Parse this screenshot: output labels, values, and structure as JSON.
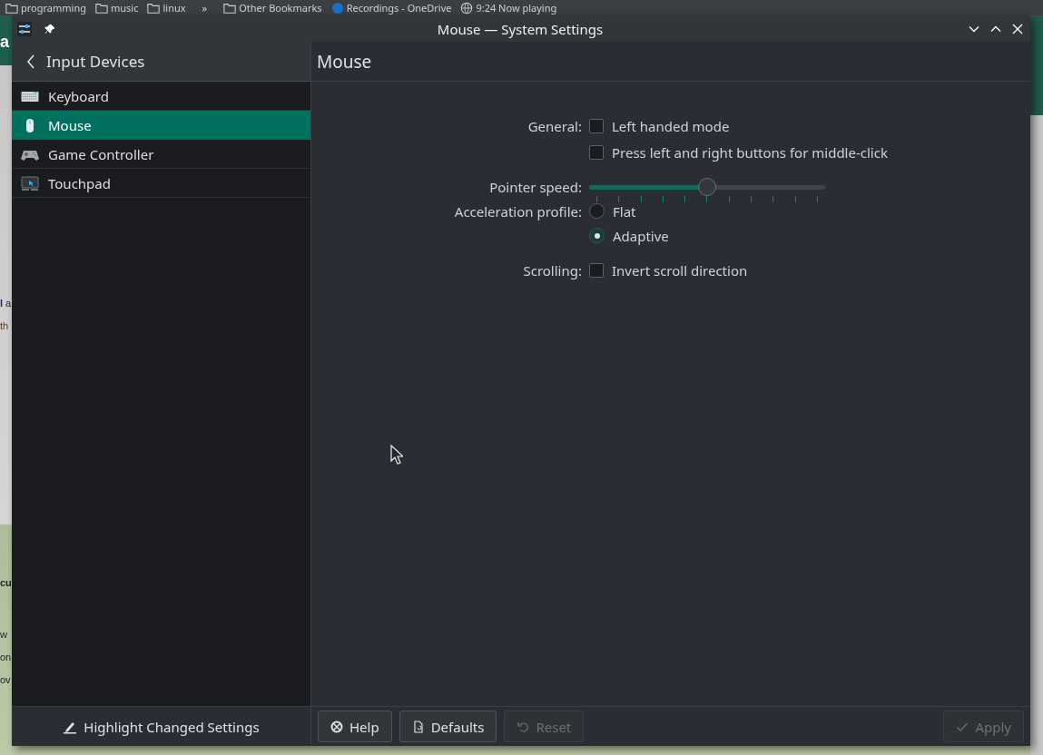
{
  "background": {
    "bookmarks": [
      {
        "kind": "folder",
        "label": "programming"
      },
      {
        "kind": "folder",
        "label": "music"
      },
      {
        "kind": "folder",
        "label": "linux"
      },
      {
        "kind": "more",
        "label": "»"
      },
      {
        "kind": "folder",
        "label": "Other Bookmarks"
      },
      {
        "kind": "site",
        "label": "Recordings - OneDrive"
      },
      {
        "kind": "globe",
        "label": "9:24 Now playing"
      }
    ],
    "page_fragments": [
      {
        "kind": "header",
        "text": "a"
      },
      {
        "kind": "text",
        "text": "**l** a"
      },
      {
        "kind": "link",
        "text": "th"
      },
      {
        "kind": "heading",
        "text": "cu"
      },
      {
        "kind": "text",
        "text": "w"
      },
      {
        "kind": "text",
        "text": "on"
      },
      {
        "kind": "text",
        "text": "ov"
      }
    ]
  },
  "window": {
    "title": "Mouse — System Settings"
  },
  "sidebar": {
    "back_title": "Input Devices",
    "items": [
      {
        "label": "Keyboard",
        "selected": false
      },
      {
        "label": "Mouse",
        "selected": true
      },
      {
        "label": "Game Controller",
        "selected": false
      },
      {
        "label": "Touchpad",
        "selected": false
      }
    ],
    "footer_button": "Highlight Changed Settings"
  },
  "page": {
    "title": "Mouse",
    "rows": [
      {
        "kind": "checkbox",
        "label": "General:",
        "text": "Left handed mode",
        "checked": false
      },
      {
        "kind": "checkbox",
        "text": "Press left and right buttons for middle-click",
        "checked": false
      },
      {
        "kind": "slider",
        "label": "Pointer speed:",
        "level": 0.5
      },
      {
        "kind": "radio",
        "label": "Acceleration profile:",
        "text": "Flat",
        "selected": false
      },
      {
        "kind": "radio",
        "text": "Adaptive",
        "selected": true
      },
      {
        "kind": "checkbox",
        "label": "Scrolling:",
        "text": "Invert scroll direction",
        "checked": false
      }
    ]
  },
  "buttons": [
    {
      "label": "Help",
      "disabled": false
    },
    {
      "label": "Defaults",
      "disabled": false
    },
    {
      "label": "Reset",
      "disabled": true
    },
    {
      "label": "Apply",
      "disabled": true
    }
  ]
}
